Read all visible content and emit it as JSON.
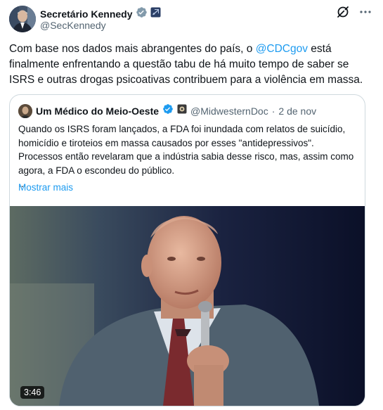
{
  "author": {
    "name": "Secretário Kennedy",
    "handle": "@SecKennedy"
  },
  "tweet": {
    "text_before": "Com base nos dados mais abrangentes do país, o ",
    "mention": "@CDCgov",
    "text_after": " está finalmente enfrentando a questão tabu de há muito tempo de saber se ISRS e outras drogas psicoativas contribuem para a violência em massa."
  },
  "quoted": {
    "name": "Um Médico do Meio-Oeste",
    "handle": "@MidwesternDoc",
    "separator": "·",
    "date": "2 de nov",
    "text": "Quando os ISRS foram lançados, a FDA foi inundada com relatos de suicídio, homicídio e tiroteios em massa causados por esses \"antidepressivos\".\nProcessos então revelaram que a indústria sabia desse risco, mas, assim como agora, a FDA o escondeu do público.\n...",
    "show_more": "Mostrar mais",
    "video_duration": "3:46"
  },
  "colors": {
    "link": "#1d9bf0",
    "verified_blue": "#1d9bf0",
    "gov_badge": "#829aab",
    "secondary_text": "#536471",
    "border": "#cfd9de"
  },
  "icons": [
    "verified-badge-icon",
    "government-badge-icon",
    "grok-icon",
    "more-options-icon",
    "organization-badge-icon"
  ]
}
